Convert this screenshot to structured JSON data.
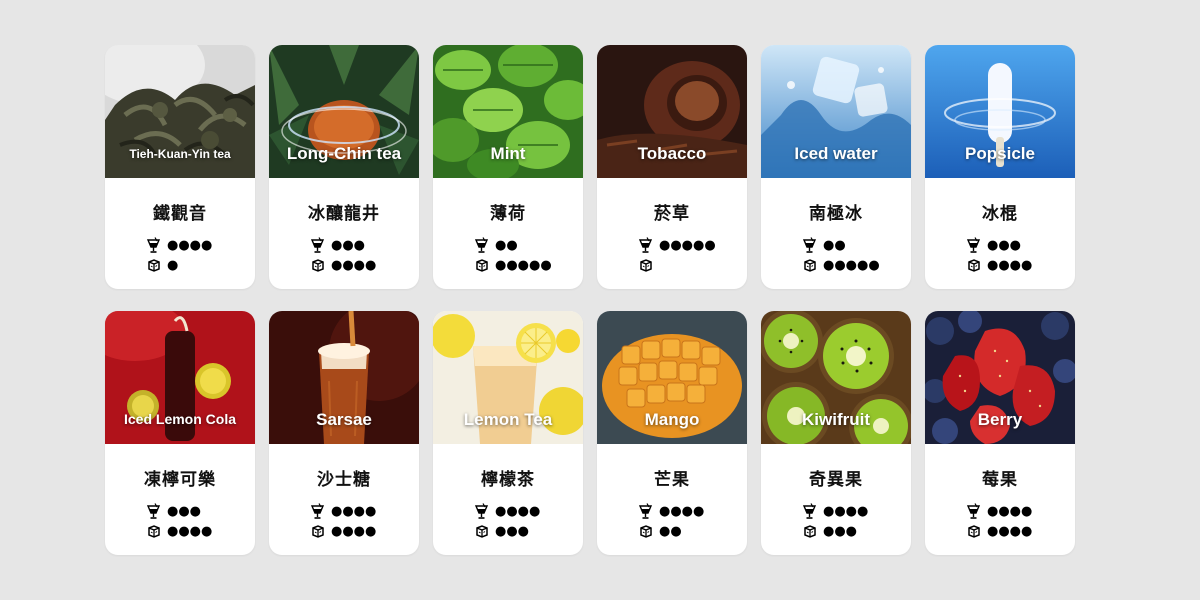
{
  "cards": [
    {
      "en": "Tieh-Kuan-Yin tea",
      "zh": "鐵觀音",
      "flavor": 4,
      "cool": 1
    },
    {
      "en": "Long-Chin tea",
      "zh": "冰釀龍井",
      "flavor": 3,
      "cool": 4
    },
    {
      "en": "Mint",
      "zh": "薄荷",
      "flavor": 2,
      "cool": 5
    },
    {
      "en": "Tobacco",
      "zh": "菸草",
      "flavor": 5,
      "cool": 0
    },
    {
      "en": "Iced water",
      "zh": "南極冰",
      "flavor": 2,
      "cool": 5
    },
    {
      "en": "Popsicle",
      "zh": "冰棍",
      "flavor": 3,
      "cool": 4
    },
    {
      "en": "Iced Lemon Cola",
      "zh": "凍檸可樂",
      "flavor": 3,
      "cool": 4
    },
    {
      "en": "Sarsae",
      "zh": "沙士糖",
      "flavor": 4,
      "cool": 4
    },
    {
      "en": "Lemon Tea",
      "zh": "檸檬茶",
      "flavor": 4,
      "cool": 3
    },
    {
      "en": "Mango",
      "zh": "芒果",
      "flavor": 4,
      "cool": 2
    },
    {
      "en": "Kiwifruit",
      "zh": "奇異果",
      "flavor": 4,
      "cool": 3
    },
    {
      "en": "Berry",
      "zh": "莓果",
      "flavor": 4,
      "cool": 4
    }
  ],
  "icons": {
    "flavor": "drink-glass-icon",
    "cool": "ice-cube-icon"
  },
  "colors": {
    "background": "#e6e6e6",
    "card": "#ffffff",
    "dots": "#000000"
  }
}
